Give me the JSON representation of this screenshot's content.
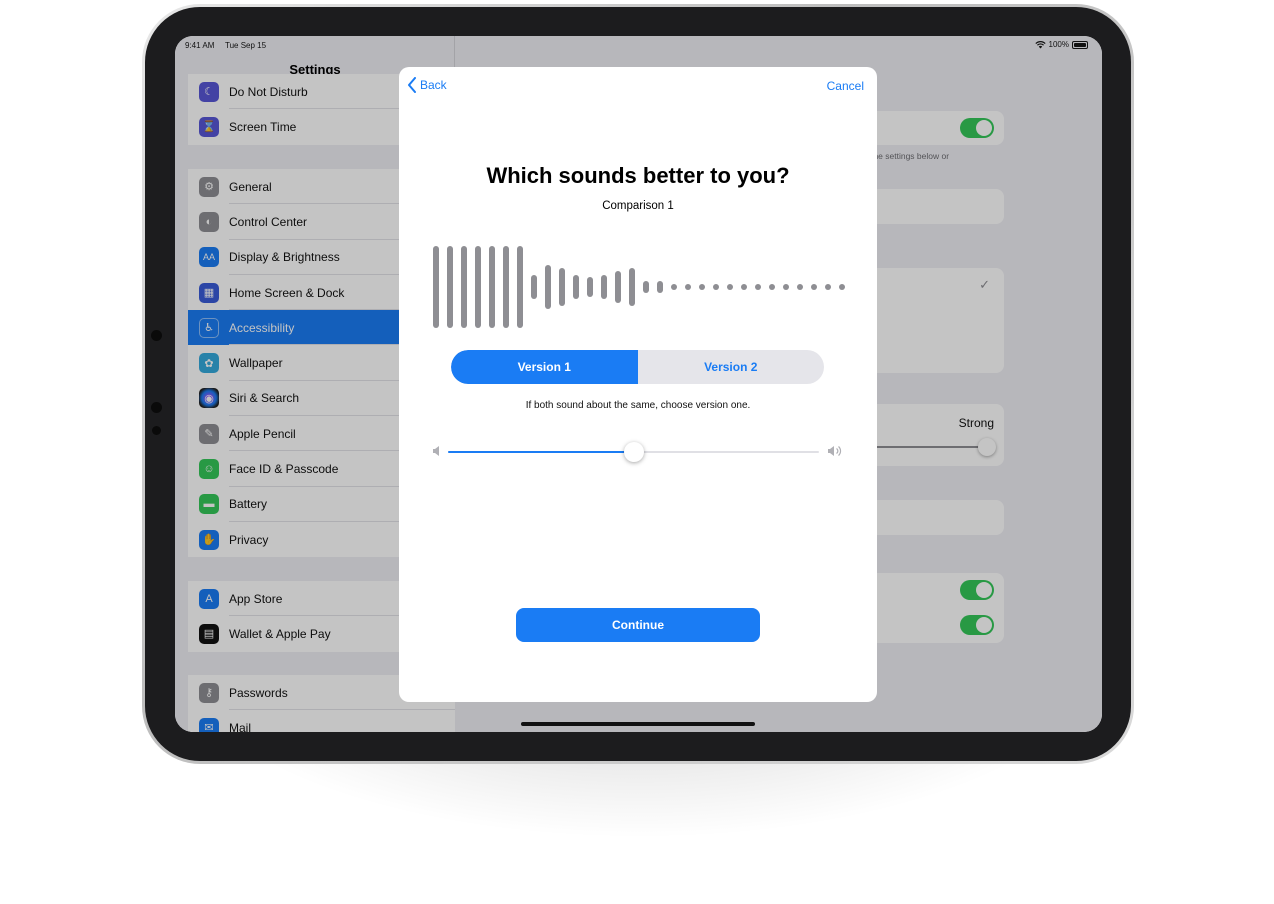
{
  "status_bar": {
    "time": "9:41 AM",
    "date": "Tue Sep 15",
    "battery": "100%"
  },
  "sidebar": {
    "title": "Settings",
    "groups": [
      [
        {
          "label": "Do Not Disturb",
          "icon": "moon-icon",
          "color": "#5856d6",
          "glyph": "☾"
        },
        {
          "label": "Screen Time",
          "icon": "hourglass-icon",
          "color": "#5856d6",
          "glyph": "⌛"
        }
      ],
      [
        {
          "label": "General",
          "icon": "gear-icon",
          "color": "#8e8e93",
          "glyph": "⚙"
        },
        {
          "label": "Control Center",
          "icon": "switches-icon",
          "color": "#8e8e93",
          "glyph": "◐"
        },
        {
          "label": "Display & Brightness",
          "icon": "text-size-icon",
          "color": "#1a7cf4",
          "glyph": "AA"
        },
        {
          "label": "Home Screen & Dock",
          "icon": "app-grid-icon",
          "color": "#3a5bd9",
          "glyph": "▦"
        },
        {
          "label": "Accessibility",
          "icon": "accessibility-icon",
          "color": "#1a7cf4",
          "glyph": "♿",
          "active": true
        },
        {
          "label": "Wallpaper",
          "icon": "flower-icon",
          "color": "#34aadc",
          "glyph": "✿"
        },
        {
          "label": "Siri & Search",
          "icon": "siri-icon",
          "color": "#222222",
          "glyph": "◉"
        },
        {
          "label": "Apple Pencil",
          "icon": "pencil-icon",
          "color": "#8e8e93",
          "glyph": "✎"
        },
        {
          "label": "Face ID & Passcode",
          "icon": "face-id-icon",
          "color": "#34c759",
          "glyph": "☺"
        },
        {
          "label": "Battery",
          "icon": "battery-icon",
          "color": "#34c759",
          "glyph": "▬"
        },
        {
          "label": "Privacy",
          "icon": "hand-icon",
          "color": "#1a7cf4",
          "glyph": "✋"
        }
      ],
      [
        {
          "label": "App Store",
          "icon": "app-store-icon",
          "color": "#1a7cf4",
          "glyph": "A"
        },
        {
          "label": "Wallet & Apple Pay",
          "icon": "wallet-icon",
          "color": "#111111",
          "glyph": "▤"
        }
      ],
      [
        {
          "label": "Passwords",
          "icon": "key-icon",
          "color": "#8e8e93",
          "glyph": "⚷"
        },
        {
          "label": "Mail",
          "icon": "mail-icon",
          "color": "#1a7cf4",
          "glyph": "✉"
        }
      ]
    ]
  },
  "detail": {
    "note": "g the settings below or",
    "strength_label": "Strong"
  },
  "modal": {
    "back_label": "Back",
    "cancel_label": "Cancel",
    "title": "Which sounds better to you?",
    "subtitle": "Comparison 1",
    "segments": {
      "version1": "Version 1",
      "version2": "Version 2",
      "selected": 0
    },
    "hint": "If both sound about the same, choose version one.",
    "volume": 0.5,
    "continue_label": "Continue"
  },
  "colors": {
    "accent": "#1a7cf4",
    "toggle_on": "#34c759",
    "waveform": "#8e8e93"
  }
}
